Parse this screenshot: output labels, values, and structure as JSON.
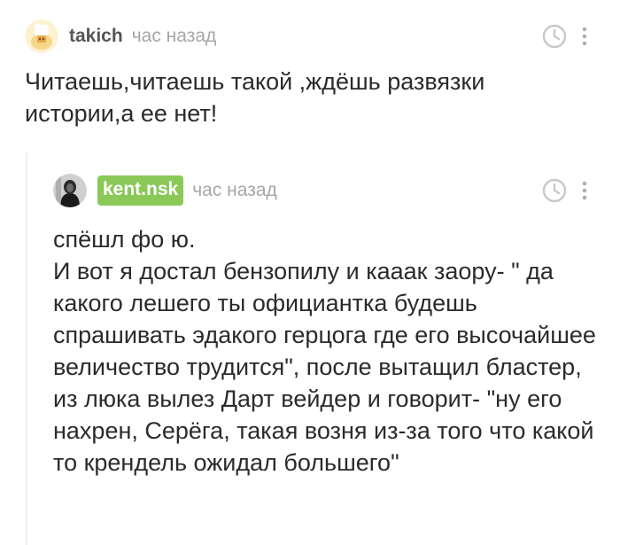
{
  "comments": [
    {
      "author": "takich",
      "time": "час назад",
      "text": "Читаешь,читаешь такой ,ждёшь развязки истории,а ее нет!",
      "avatar_icon": "cat-avatar-icon"
    },
    {
      "author": "kent.nsk",
      "time": "час назад",
      "text": "спёшл фо ю.\nИ вот я достал бензопилу и кааак заору- \" да какого лешего ты официантка будешь спрашивать эдакого герцога где его высочайшее величество трудится\", после вытащил бластер, из люка вылез Дарт вейдер и говорит- \"ну его нахрен, Серёга, такая возня из-за того что какой то крендель ожидал большего\"",
      "avatar_icon": "dark-portrait-avatar-icon",
      "badge_color": "#8ac858"
    }
  ],
  "colors": {
    "author_badge": "#8ac858",
    "time_text": "#a6a6a6",
    "body_text": "#2b2b2b",
    "thread_line": "#eeeeee"
  }
}
